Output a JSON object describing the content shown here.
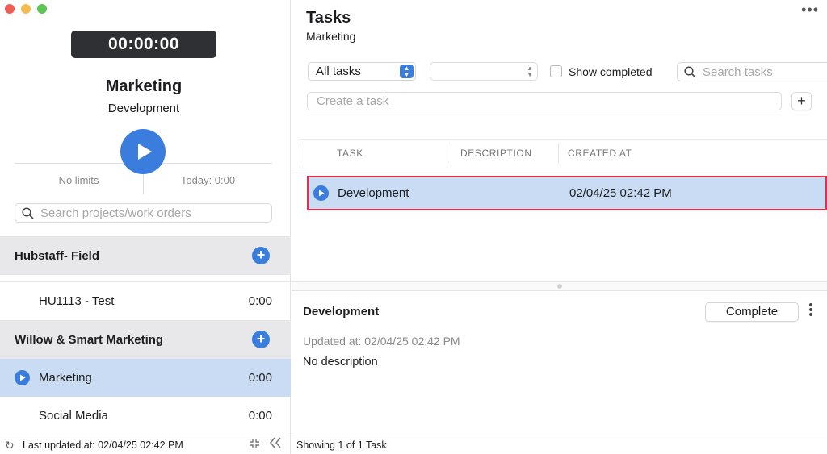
{
  "colors": {
    "accent": "#3b7ddd",
    "selected_row": "#c9dcf3",
    "highlight_border": "#e0304a",
    "timer_bg": "#2f3033"
  },
  "timer": {
    "value": "00:00:00"
  },
  "current": {
    "project": "Marketing",
    "task": "Development"
  },
  "stats": {
    "limits": "No limits",
    "today": "Today: 0:00"
  },
  "project_search": {
    "placeholder": "Search projects/work orders"
  },
  "groups": [
    {
      "name": "Hubstaff- Field",
      "items": [
        {
          "name": "HU1113 - Test",
          "time": "0:00"
        }
      ]
    },
    {
      "name": "Willow & Smart Marketing",
      "items": [
        {
          "name": "Marketing",
          "time": "0:00",
          "selected": true
        },
        {
          "name": "Social Media",
          "time": "0:00"
        }
      ]
    }
  ],
  "left_footer": {
    "updated": "Last updated at: 02/04/25 02:42 PM"
  },
  "tasks_panel": {
    "title": "Tasks",
    "subtitle": "Marketing",
    "filter_select": "All tasks",
    "second_select": "",
    "show_completed_label": "Show completed",
    "show_completed_checked": false,
    "search_placeholder": "Search tasks",
    "create_placeholder": "Create a task",
    "add_label": "+",
    "columns": [
      "TASK",
      "DESCRIPTION",
      "CREATED AT"
    ],
    "rows": [
      {
        "task": "Development",
        "description": "",
        "created_at": "02/04/25 02:42 PM"
      }
    ]
  },
  "detail": {
    "title": "Development",
    "complete_label": "Complete",
    "updated": "Updated at: 02/04/25 02:42 PM",
    "description": "No description"
  },
  "right_footer": {
    "status": "Showing 1 of 1 Task"
  }
}
